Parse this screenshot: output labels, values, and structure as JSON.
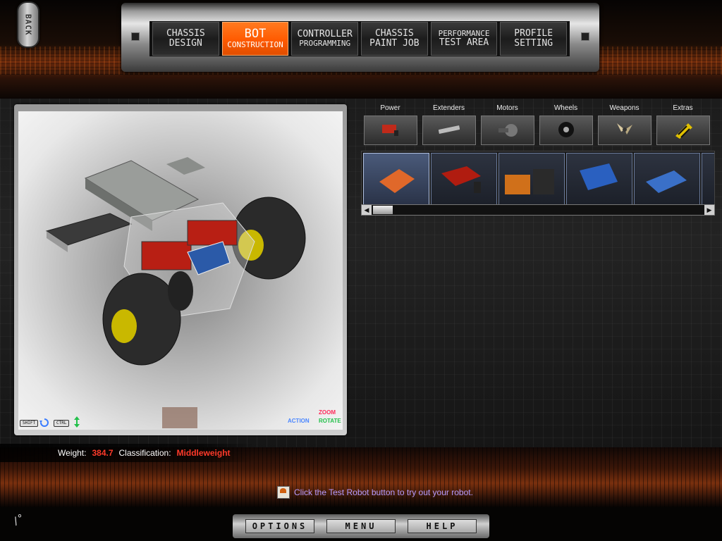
{
  "back_label": "BACK",
  "nav_tabs": [
    {
      "l1": "CHASSIS",
      "l2": "DESIGN"
    },
    {
      "l1": "BOT",
      "l2": "CONSTRUCTION"
    },
    {
      "l1": "CONTROLLER",
      "l2": "PROGRAMMING"
    },
    {
      "l1": "CHASSIS",
      "l2": "PAINT JOB"
    },
    {
      "l1": "PERFORMANCE",
      "l2": "TEST AREA"
    },
    {
      "l1": "PROFILE",
      "l2": "SETTING"
    }
  ],
  "active_tab": "BOT",
  "categories": [
    "Power",
    "Extenders",
    "Motors",
    "Wheels",
    "Weapons",
    "Extras"
  ],
  "viewport_hints": {
    "shift": "SHIFT",
    "ctrl": "CTRL",
    "action": "ACTION",
    "zoom": "ZOOM",
    "rotate": "ROTATE"
  },
  "stats": {
    "weight_label": "Weight:",
    "weight_value": "384.7",
    "class_label": "Classification:",
    "class_value": "Middleweight"
  },
  "tip_text": "Click the Test Robot button to try out your robot.",
  "bottom_menu": [
    "OPTIONS",
    "MENU",
    "HELP"
  ],
  "fps_text": "/°",
  "colors": {
    "accent": "#ff5a00",
    "stat_value": "#ff3a2a",
    "tip": "#b89cff"
  }
}
